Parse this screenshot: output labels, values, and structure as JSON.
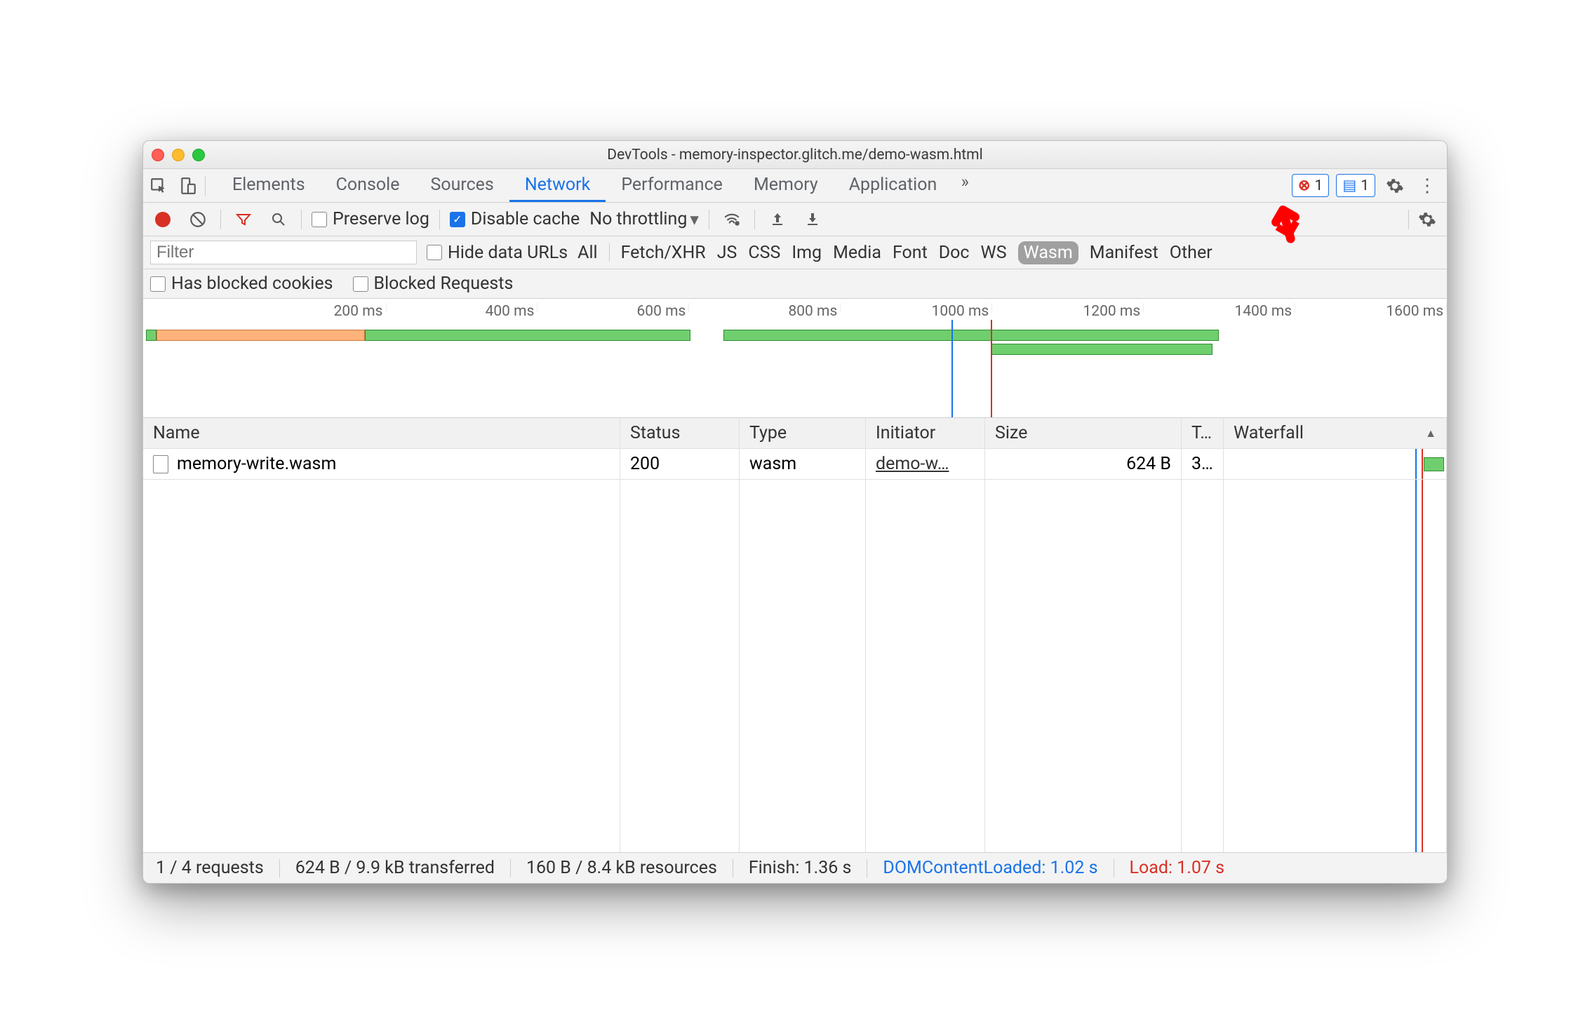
{
  "window": {
    "title": "DevTools - memory-inspector.glitch.me/demo-wasm.html"
  },
  "tabs": [
    "Elements",
    "Console",
    "Sources",
    "Network",
    "Performance",
    "Memory",
    "Application"
  ],
  "active_tab": "Network",
  "top_badges": {
    "errors": "1",
    "messages": "1"
  },
  "toolbar": {
    "preserve_log": "Preserve log",
    "disable_cache": "Disable cache",
    "throttling": "No throttling"
  },
  "filter": {
    "placeholder": "Filter",
    "hide_data_urls": "Hide data URLs",
    "types": [
      "All",
      "Fetch/XHR",
      "JS",
      "CSS",
      "Img",
      "Media",
      "Font",
      "Doc",
      "WS",
      "Wasm",
      "Manifest",
      "Other"
    ],
    "active_type": "Wasm",
    "has_blocked_cookies": "Has blocked cookies",
    "blocked_requests": "Blocked Requests"
  },
  "timeline": {
    "ticks": [
      "200 ms",
      "400 ms",
      "600 ms",
      "800 ms",
      "1000 ms",
      "1200 ms",
      "1400 ms",
      "1600 ms"
    ]
  },
  "grid": {
    "headers": {
      "name": "Name",
      "status": "Status",
      "type": "Type",
      "initiator": "Initiator",
      "size": "Size",
      "time": "T…",
      "waterfall": "Waterfall"
    },
    "rows": [
      {
        "name": "memory-write.wasm",
        "status": "200",
        "type": "wasm",
        "initiator": "demo-w…",
        "size": "624 B",
        "time": "3…"
      }
    ]
  },
  "status": {
    "requests": "1 / 4 requests",
    "transferred": "624 B / 9.9 kB transferred",
    "resources": "160 B / 8.4 kB resources",
    "finish": "Finish: 1.36 s",
    "dcl": "DOMContentLoaded: 1.02 s",
    "load": "Load: 1.07 s"
  }
}
